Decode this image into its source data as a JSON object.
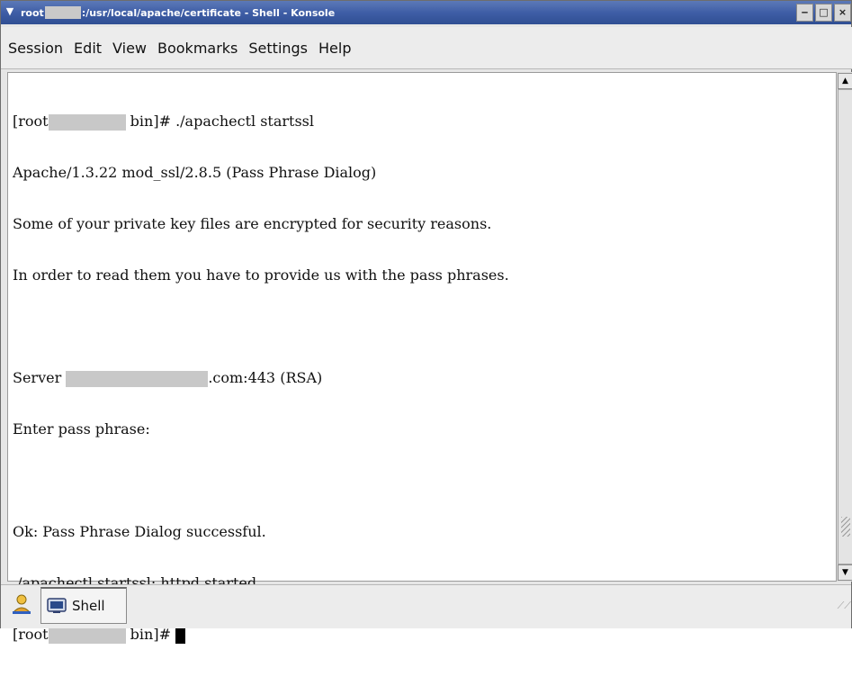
{
  "window": {
    "title_prefix": "root",
    "title_suffix": ":/usr/local/apache/certificate - Shell - Konsole",
    "controls": {
      "minimize": "‒",
      "maximize": "□",
      "close": "×"
    }
  },
  "menubar": {
    "items": [
      "Session",
      "Edit",
      "View",
      "Bookmarks",
      "Settings",
      "Help"
    ]
  },
  "terminal": {
    "line1_a": "[root",
    "line1_b": " bin]# ./apachectl startssl",
    "line2": "Apache/1.3.22 mod_ssl/2.8.5 (Pass Phrase Dialog)",
    "line3": "Some of your private key files are encrypted for security reasons.",
    "line4": "In order to read them you have to provide us with the pass phrases.",
    "line5": "",
    "line6_a": "Server ",
    "line6_b": ".com:443 (RSA)",
    "line7": "Enter pass phrase:",
    "line8": "",
    "line9": "Ok: Pass Phrase Dialog successful.",
    "line10": "./apachectl startssl: httpd started",
    "line11_a": "[root",
    "line11_b": " bin]# "
  },
  "tabbar": {
    "tab_label": "Shell"
  },
  "icons": {
    "window_menu": "chevron-down-icon",
    "new_session": "new-session-icon",
    "shell_tab": "terminal-icon"
  },
  "colors": {
    "titlebar": "#3f5ea6",
    "redaction": "#c8c8c8",
    "cursor": "#000000"
  }
}
